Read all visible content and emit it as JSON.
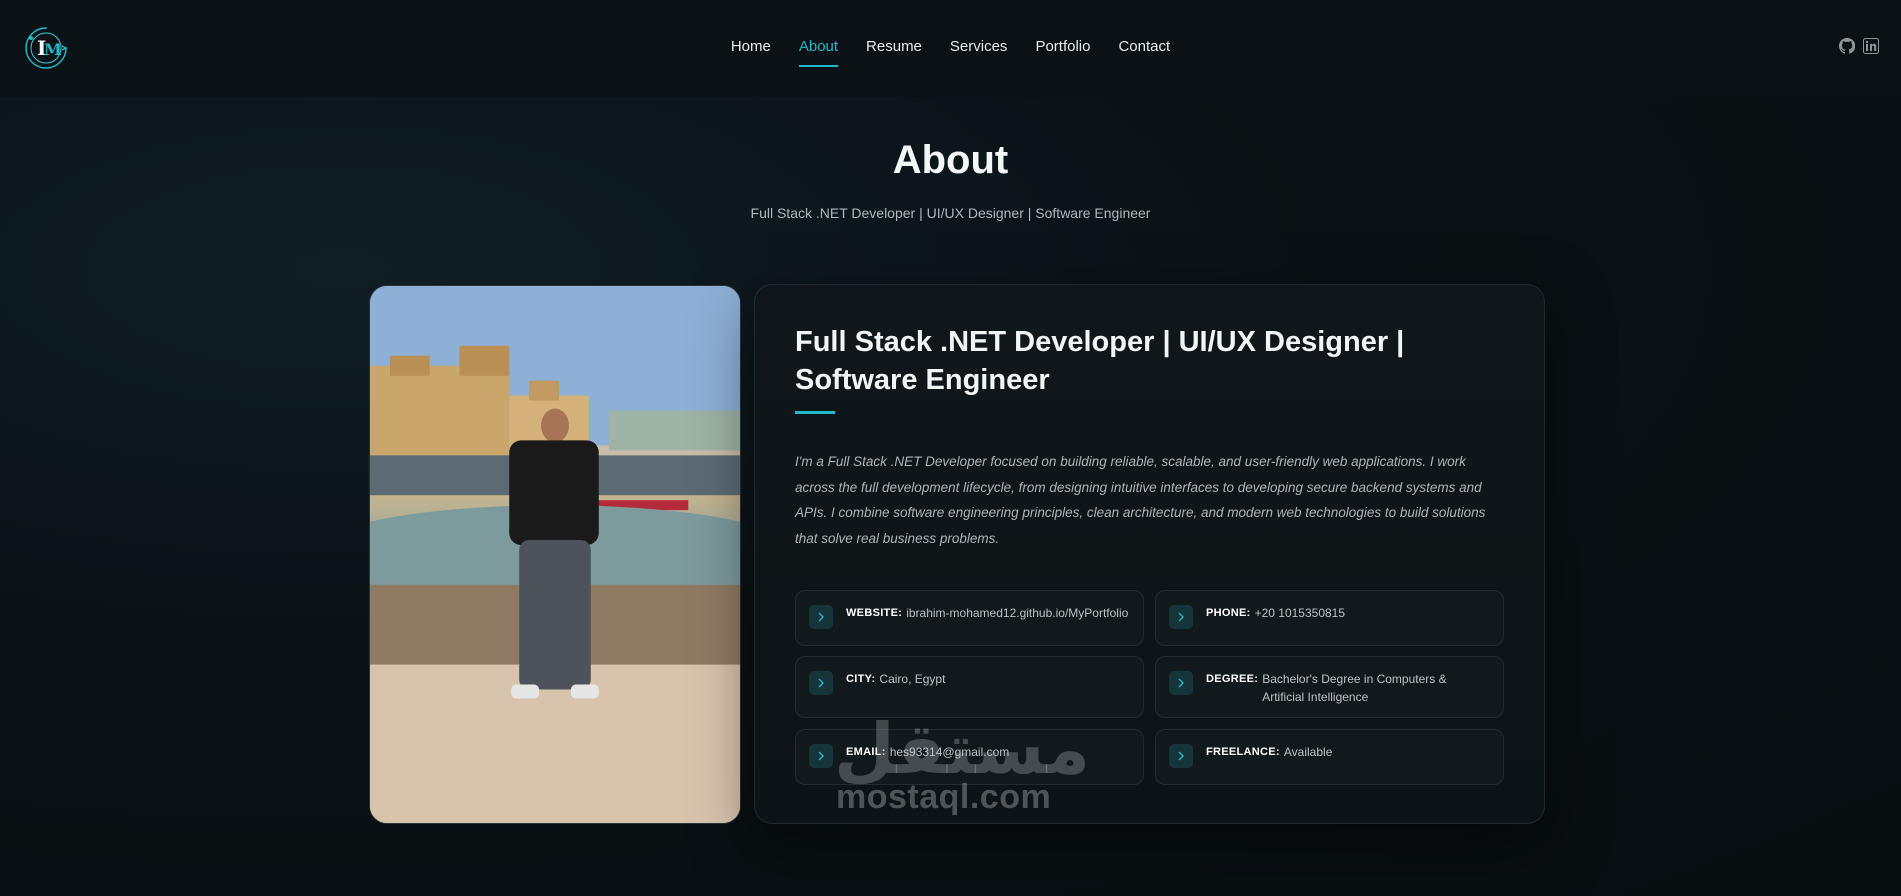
{
  "nav": {
    "items": [
      {
        "label": "Home",
        "active": false
      },
      {
        "label": "About",
        "active": true
      },
      {
        "label": "Resume",
        "active": false
      },
      {
        "label": "Services",
        "active": false
      },
      {
        "label": "Portfolio",
        "active": false
      },
      {
        "label": "Contact",
        "active": false
      }
    ],
    "accent": "#22b8cc"
  },
  "social": [
    "github-icon",
    "linkedin-icon"
  ],
  "section": {
    "title": "About",
    "subtitle": "Full Stack .NET Developer | UI/UX Designer | Software Engineer"
  },
  "card": {
    "title": "Full Stack .NET Developer | UI/UX Designer | Software Engineer",
    "description": "I'm a Full Stack .NET Developer focused on building reliable, scalable, and user-friendly web applications. I work across the full development lifecycle, from designing intuitive interfaces to developing secure backend systems and APIs. I combine software engineering principles, clean architecture, and modern web technologies to build solutions that solve real business problems.",
    "info": {
      "website": {
        "label": "WEBSITE:",
        "value": "ibrahim-mohamed12.github.io/MyPortfolio"
      },
      "phone": {
        "label": "PHONE:",
        "value": "+20 1015350815"
      },
      "city": {
        "label": "CITY:",
        "value": "Cairo, Egypt"
      },
      "degree": {
        "label": "DEGREE:",
        "value": "Bachelor's Degree in Computers & Artificial Intelligence"
      },
      "email": {
        "label": "EMAIL:",
        "value": "hes93314@gmail.com"
      },
      "freelance": {
        "label": "FREELANCE:",
        "value": "Available"
      }
    }
  },
  "watermark": {
    "latin": "mostaql.com",
    "arabic": "مستقل"
  }
}
